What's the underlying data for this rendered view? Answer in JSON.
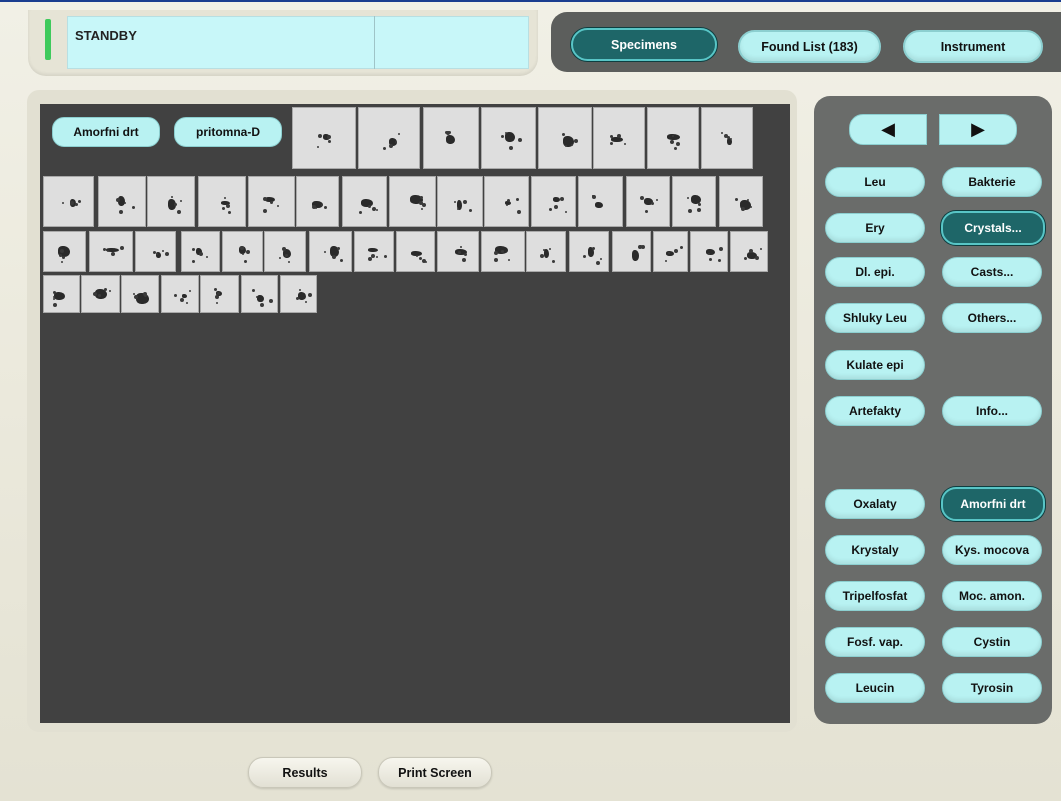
{
  "status": {
    "text": "STANDBY",
    "led_color": "#3fca5c"
  },
  "nav": {
    "specimens": "Specimens",
    "found_list": "Found List (183)",
    "instrument": "Instrument"
  },
  "tags": [
    "Amorfni drt",
    "pritomna-D"
  ],
  "thumbnails": {
    "count": 49
  },
  "side": {
    "categories": [
      {
        "label": "Leu"
      },
      {
        "label": "Bakterie"
      },
      {
        "label": "Ery"
      },
      {
        "label": "Crystals...",
        "active": true
      },
      {
        "label": "Dl. epi."
      },
      {
        "label": "Casts..."
      },
      {
        "label": "Shluky Leu"
      },
      {
        "label": "Others..."
      },
      {
        "label": "Kulate epi"
      },
      {
        "label": "Artefakty"
      },
      {
        "label": "Info..."
      }
    ],
    "subcategories": [
      {
        "label": "Oxalaty"
      },
      {
        "label": "Amorfni drt",
        "active": true
      },
      {
        "label": "Krystaly"
      },
      {
        "label": "Kys. mocova"
      },
      {
        "label": "Tripelfosfat"
      },
      {
        "label": "Moc. amon."
      },
      {
        "label": "Fosf. vap."
      },
      {
        "label": "Cystin"
      },
      {
        "label": "Leucin"
      },
      {
        "label": "Tyrosin"
      }
    ]
  },
  "bottom": {
    "results": "Results",
    "print_screen": "Print Screen"
  },
  "colors": {
    "accent": "#b8f2f2",
    "active": "#1e6668",
    "panel_dark": "#414141"
  }
}
